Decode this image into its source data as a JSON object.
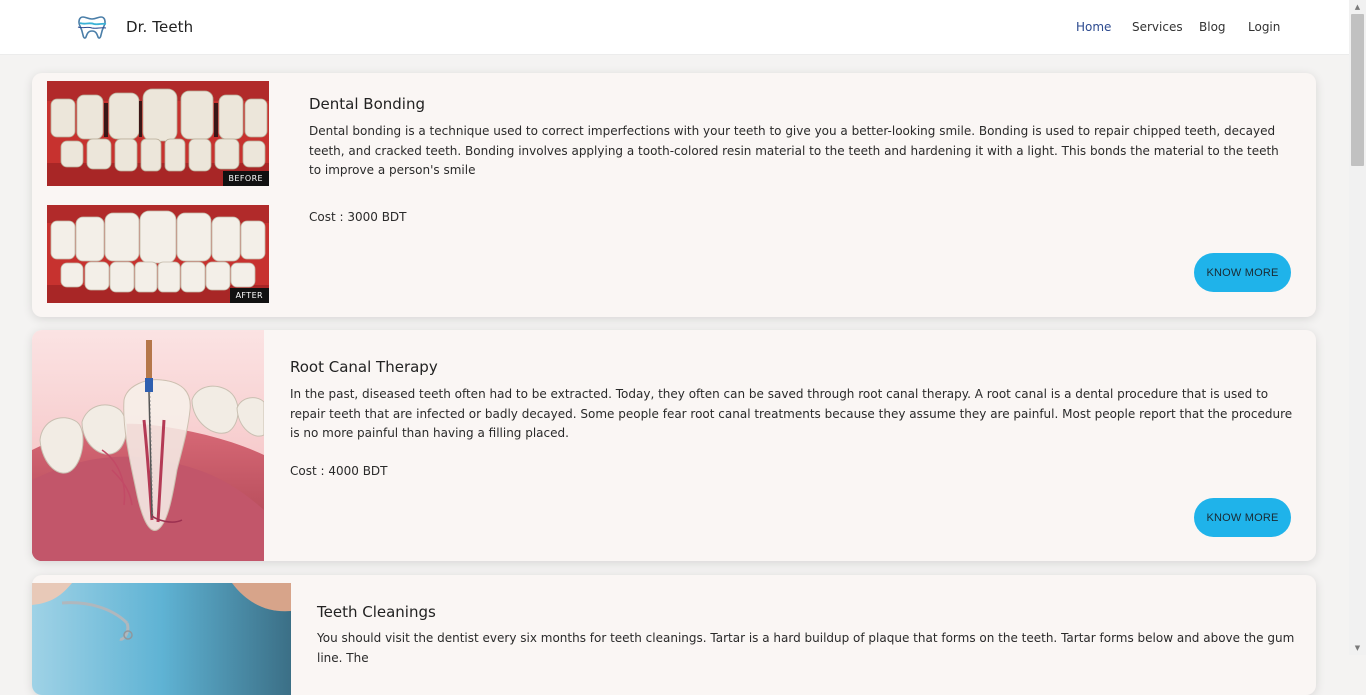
{
  "nav": {
    "brand": "Dr. Teeth",
    "links": [
      {
        "label": "Home",
        "active": true
      },
      {
        "label": "Services",
        "active": false
      },
      {
        "label": "Blog",
        "active": false
      },
      {
        "label": "Login",
        "active": false
      }
    ]
  },
  "services": [
    {
      "title": "Dental Bonding",
      "description": "Dental bonding is a technique used to correct imperfections with your teeth to give you a better-looking smile. Bonding is used to repair chipped teeth, decayed teeth, and cracked teeth. Bonding involves applying a tooth-colored resin material to the teeth and hardening it with a light. This bonds the material to the teeth to improve a person's smile",
      "cost": "Cost : 3000 BDT",
      "button": "KNOW MORE",
      "image_labels": {
        "before": "BEFORE",
        "after": "AFTER"
      }
    },
    {
      "title": "Root Canal Therapy",
      "description": "In the past, diseased teeth often had to be extracted. Today, they often can be saved through root canal therapy. A root canal is a dental procedure that is used to repair teeth that are infected or badly decayed. Some people fear root canal treatments because they assume they are painful. Most people report that the procedure is no more painful than having a filling placed.",
      "cost": "Cost : 4000 BDT",
      "button": "KNOW MORE"
    },
    {
      "title": "Teeth Cleanings",
      "description": "You should visit the dentist every six months for teeth cleanings. Tartar is a hard buildup of plaque that forms on the teeth. Tartar forms below and above the gum line. The"
    }
  ],
  "colors": {
    "accent": "#1fb3ea",
    "nav_active": "#2c4a8f",
    "card_bg": "#faf6f4",
    "page_bg": "#f4f3f2"
  }
}
